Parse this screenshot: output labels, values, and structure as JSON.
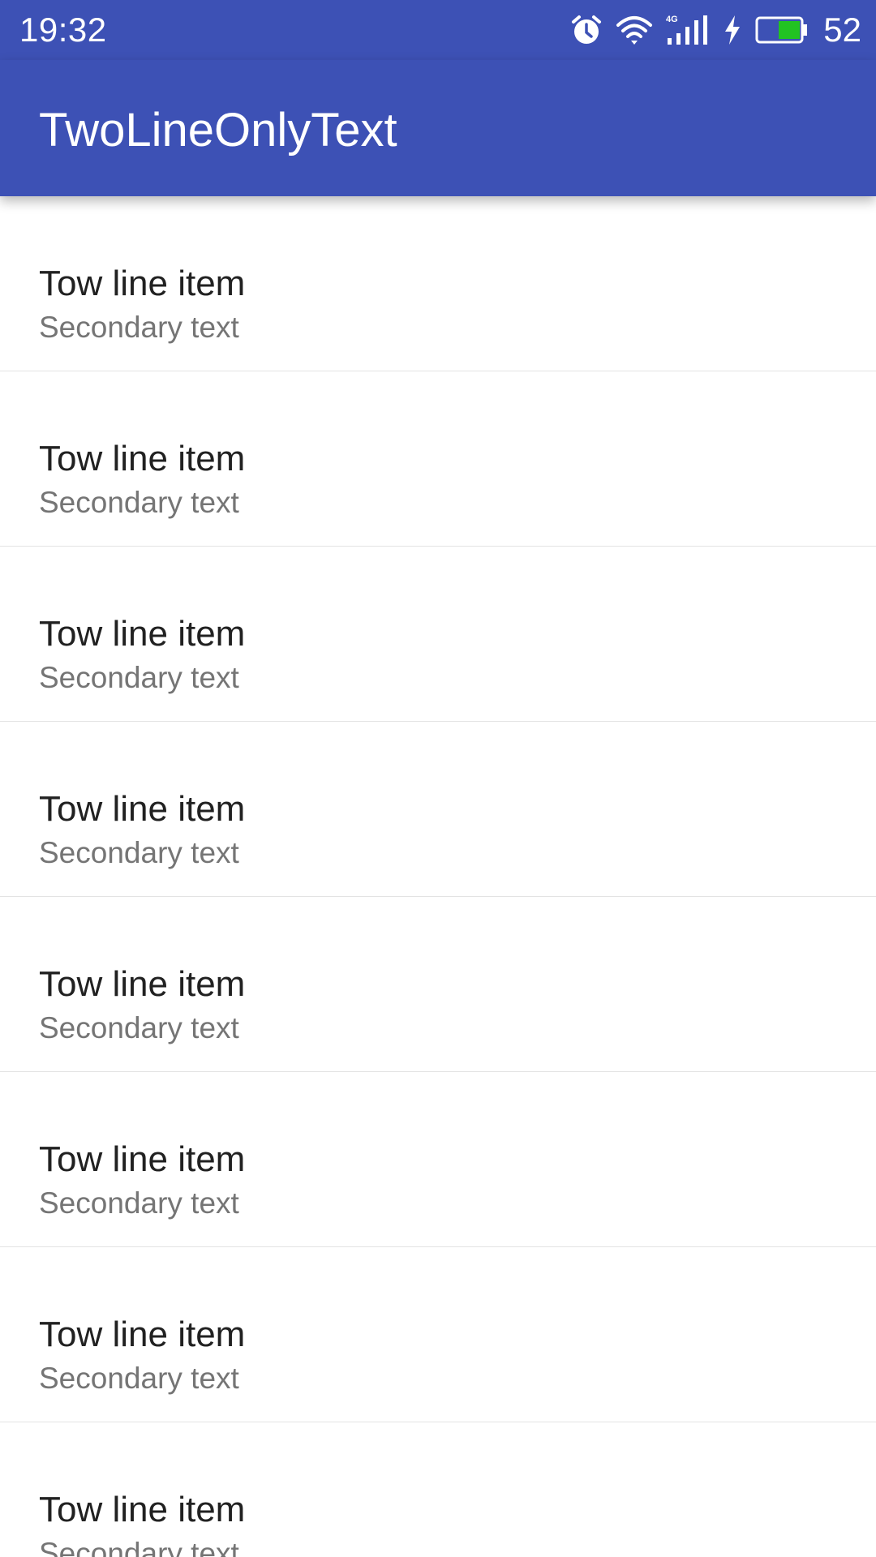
{
  "status_bar": {
    "time": "19:32",
    "battery_percent": "52",
    "icons": [
      "alarm-icon",
      "wifi-icon",
      "signal-4g-icon",
      "charging-icon",
      "battery-icon"
    ],
    "battery_fill_color": "#22c322"
  },
  "app_bar": {
    "title": "TwoLineOnlyText",
    "color": "#3d51b5"
  },
  "list": {
    "items": [
      {
        "primary": "Tow line item",
        "secondary": "Secondary text"
      },
      {
        "primary": "Tow line item",
        "secondary": "Secondary text"
      },
      {
        "primary": "Tow line item",
        "secondary": "Secondary text"
      },
      {
        "primary": "Tow line item",
        "secondary": "Secondary text"
      },
      {
        "primary": "Tow line item",
        "secondary": "Secondary text"
      },
      {
        "primary": "Tow line item",
        "secondary": "Secondary text"
      },
      {
        "primary": "Tow line item",
        "secondary": "Secondary text"
      },
      {
        "primary": "Tow line item",
        "secondary": "Secondary text"
      }
    ]
  }
}
